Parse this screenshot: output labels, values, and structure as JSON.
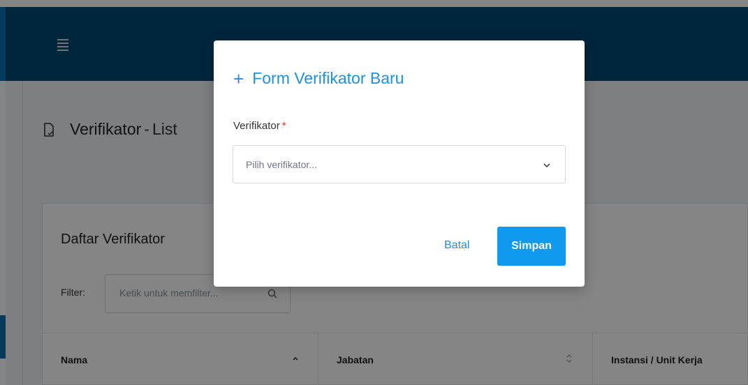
{
  "header": {
    "menu_icon": "hamburger-icon",
    "bar_color": "#014a73"
  },
  "page": {
    "title_main": "Verifikator",
    "title_sep": "-",
    "title_sub": "List",
    "title_icon": "file-icon"
  },
  "card": {
    "title": "Daftar Verifikator",
    "filter_label": "Filter:",
    "filter_placeholder": "Ketik untuk memfilter...",
    "filter_icon": "search-icon"
  },
  "table": {
    "columns": [
      {
        "label": "Nama",
        "sort": "asc"
      },
      {
        "label": "Jabatan",
        "sort": "none"
      },
      {
        "label": "Instansi / Unit Kerja",
        "sort": "none"
      }
    ]
  },
  "modal": {
    "title_icon": "plus-icon",
    "title": "Form Verifikator Baru",
    "field_label": "Verifikator",
    "required_mark": "*",
    "select_placeholder": "Pilih verifikator...",
    "cancel_label": "Batal",
    "save_label": "Simpan",
    "accent_color": "#1e91df",
    "button_color": "#0f9af0"
  }
}
